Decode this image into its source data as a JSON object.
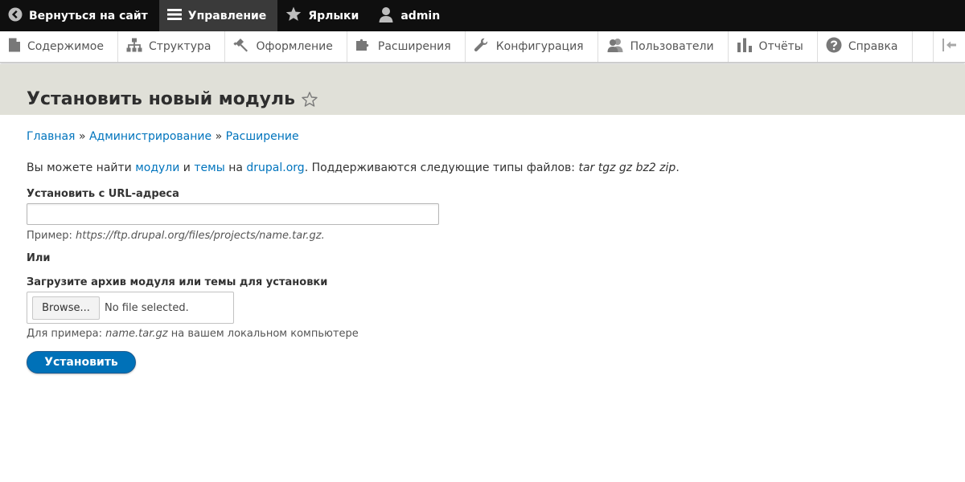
{
  "toolbar": {
    "back_label": "Вернуться на сайт",
    "manage_label": "Управление",
    "shortcuts_label": "Ярлыки",
    "user_label": "admin"
  },
  "admin_menu": {
    "items": [
      {
        "label": "Содержимое",
        "icon": "file-icon"
      },
      {
        "label": "Структура",
        "icon": "structure-icon"
      },
      {
        "label": "Оформление",
        "icon": "paintbrush-icon"
      },
      {
        "label": "Расширения",
        "icon": "puzzle-icon"
      },
      {
        "label": "Конфигурация",
        "icon": "wrench-icon"
      },
      {
        "label": "Пользователи",
        "icon": "people-icon"
      },
      {
        "label": "Отчёты",
        "icon": "bar-chart-icon"
      },
      {
        "label": "Справка",
        "icon": "help-icon"
      }
    ]
  },
  "page": {
    "title": "Установить новый модуль"
  },
  "breadcrumb": {
    "home": "Главная",
    "admin": "Администрирование",
    "extend": "Расширение",
    "separator": "»"
  },
  "help": {
    "prefix": "Вы можете найти ",
    "modules_link": "модули",
    "and": " и ",
    "themes_link": "темы",
    "on": " на ",
    "site_link": "drupal.org",
    "suffix": ". Поддерживаются следующие типы файлов: ",
    "types": "tar tgz gz bz2 zip",
    "end": "."
  },
  "form": {
    "url_label": "Установить с URL-адреса",
    "url_value": "",
    "url_example_prefix": "Пример: ",
    "url_example": "https://ftp.drupal.org/files/projects/name.tar.gz.",
    "or_label": "Или",
    "upload_label": "Загрузите архив модуля или темы для установки",
    "browse_label": "Browse...",
    "file_status": "No file selected.",
    "upload_example_prefix": "Для примера: ",
    "upload_example": "name.tar.gz",
    "upload_example_suffix": " на вашем локальном компьютере",
    "submit_label": "Установить"
  },
  "colors": {
    "toolbar_bg": "#0f0f0f",
    "link": "#0074bd",
    "primary_button": "#0071b8",
    "header_bg": "#e0e0d8"
  }
}
